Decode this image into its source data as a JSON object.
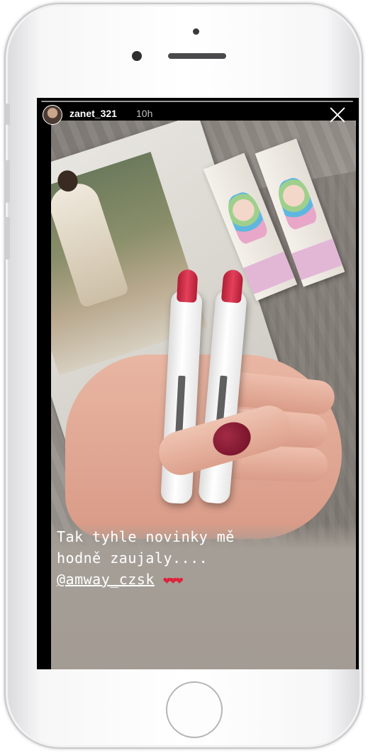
{
  "story": {
    "username": "zanet_321",
    "time": "10h",
    "caption": {
      "line1": "Tak tyhle novinky mě",
      "line2": "hodně zaujaly....",
      "mention": "@amway_czsk",
      "hearts": "❤❤❤"
    }
  },
  "colors": {
    "lipstick": "#d63450",
    "heart": "#e0213a",
    "caption_bg": "#a39c94"
  },
  "icons": {
    "close": "close-icon",
    "avatar": "avatar"
  }
}
